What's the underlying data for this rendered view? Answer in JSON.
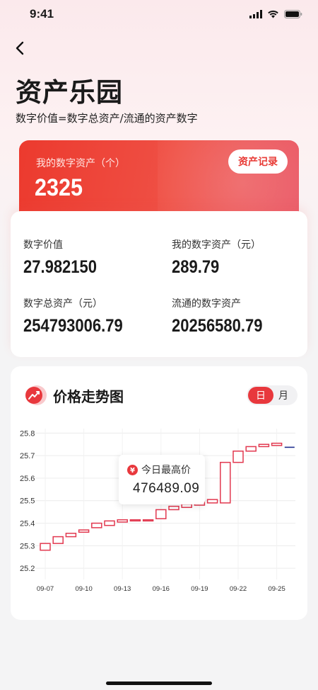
{
  "status_bar": {
    "time": "9:41"
  },
  "header": {
    "title": "资产乐园",
    "subtitle": "数字价值=数字总资产/流通的资产数字"
  },
  "asset_card": {
    "label": "我的数字资产（个）",
    "value": "2325",
    "record_button": "资产记录"
  },
  "stats": [
    {
      "label": "数字价值",
      "value": "27.982150"
    },
    {
      "label": "我的数字资产（元）",
      "value": "289.79"
    },
    {
      "label": "数字总资产（元）",
      "value": "254793006.79"
    },
    {
      "label": "流通的数字资产",
      "value": "20256580.79"
    }
  ],
  "trend": {
    "title": "价格走势图",
    "toggle_day": "日",
    "toggle_month": "月",
    "tooltip_label": "今日最高价",
    "tooltip_value": "476489.09",
    "currency_symbol": "¥"
  },
  "colors": {
    "accent": "#e8383d",
    "candle": "#e2384f",
    "last_line": "#1f2f8f"
  },
  "chart_data": {
    "type": "candlestick",
    "ylim": [
      25.15,
      25.82
    ],
    "yticks": [
      25.2,
      25.3,
      25.4,
      25.5,
      25.6,
      25.7,
      25.8
    ],
    "xticks": [
      "09-07",
      "09-10",
      "09-13",
      "09-16",
      "09-19",
      "09-22",
      "09-25"
    ],
    "x": [
      "09-07",
      "09-08",
      "09-09",
      "09-10",
      "09-11",
      "09-12",
      "09-13",
      "09-14",
      "09-15",
      "09-16",
      "09-17",
      "09-18",
      "09-19",
      "09-20",
      "09-21",
      "09-22",
      "09-23",
      "09-24",
      "09-25",
      "09-26"
    ],
    "series": [
      {
        "open": [
          25.28,
          25.31,
          25.34,
          25.36,
          25.38,
          25.39,
          25.405,
          25.41,
          25.41,
          25.42,
          25.46,
          25.47,
          25.48,
          25.49,
          25.49,
          25.67,
          25.72,
          25.74,
          25.745,
          25.737
        ],
        "close": [
          25.31,
          25.34,
          25.355,
          25.37,
          25.4,
          25.41,
          25.415,
          25.415,
          25.415,
          25.46,
          25.475,
          25.485,
          25.495,
          25.505,
          25.67,
          25.72,
          25.74,
          25.75,
          25.755,
          25.737
        ]
      }
    ]
  }
}
